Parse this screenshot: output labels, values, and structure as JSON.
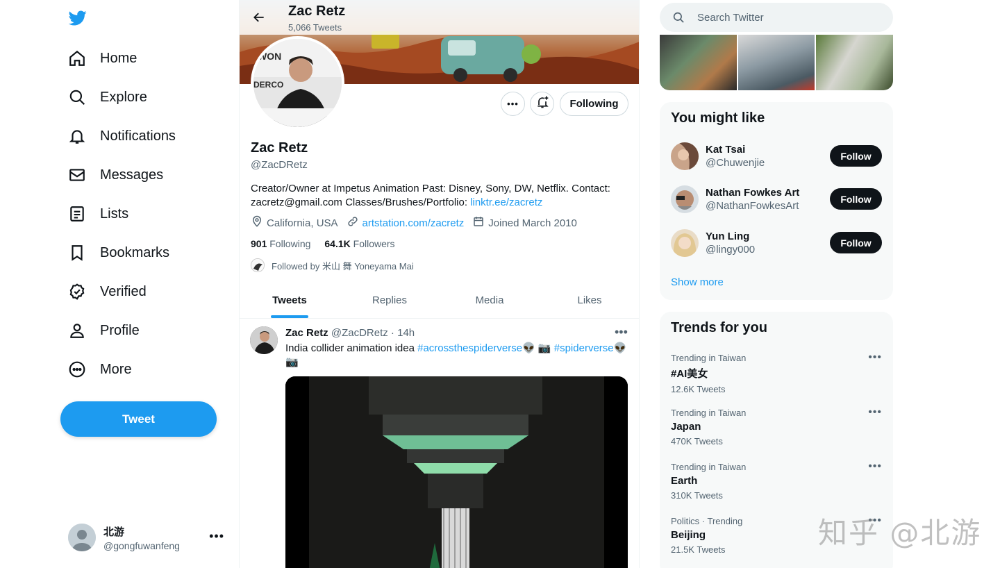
{
  "nav": {
    "items": [
      {
        "label": "Home",
        "icon": "home-icon"
      },
      {
        "label": "Explore",
        "icon": "search-icon"
      },
      {
        "label": "Notifications",
        "icon": "bell-icon"
      },
      {
        "label": "Messages",
        "icon": "mail-icon"
      },
      {
        "label": "Lists",
        "icon": "list-icon"
      },
      {
        "label": "Bookmarks",
        "icon": "bookmark-icon"
      },
      {
        "label": "Verified",
        "icon": "verified-icon"
      },
      {
        "label": "Profile",
        "icon": "person-icon"
      },
      {
        "label": "More",
        "icon": "more-circle-icon"
      }
    ],
    "tweet_button": "Tweet",
    "account": {
      "name": "北游",
      "handle": "@gongfuwanfeng"
    }
  },
  "colors": {
    "accent": "#1d9bf0",
    "text": "#0f1419",
    "muted": "#536471"
  },
  "profile": {
    "header_name": "Zac Retz",
    "tweet_count": "5,066 Tweets",
    "name": "Zac Retz",
    "handle": "@ZacDRetz",
    "bio_text": "Creator/Owner at Impetus Animation Past: Disney, Sony, DW, Netflix. Contact: zacretz@gmail.com Classes/Brushes/Portfolio: ",
    "bio_link": "linktr.ee/zacretz",
    "location": "California, USA",
    "website": "artstation.com/zacretz",
    "joined": "Joined March 2010",
    "following_count": "901",
    "following_label": "Following",
    "followers_count": "64.1K",
    "followers_label": "Followers",
    "followed_by": "Followed by 米山 舞 Yoneyama Mai",
    "following_button": "Following"
  },
  "tabs": [
    "Tweets",
    "Replies",
    "Media",
    "Likes"
  ],
  "tweet": {
    "name": "Zac Retz",
    "meta": "@ZacDRetz · 14h",
    "text": "India collider animation idea",
    "hashtag1": "#acrossthespiderverse",
    "hashtag2": "#spiderverse",
    "emoji1": "👽 📷",
    "emoji2": "👽",
    "emoji3": "📷"
  },
  "search": {
    "placeholder": "Search Twitter"
  },
  "you_might_like": {
    "title": "You might like",
    "users": [
      {
        "name": "Kat Tsai",
        "handle": "@Chuwenjie",
        "button": "Follow"
      },
      {
        "name": "Nathan Fowkes Art",
        "handle": "@NathanFowkesArt",
        "button": "Follow"
      },
      {
        "name": "Yun Ling",
        "handle": "@lingy000",
        "button": "Follow"
      }
    ],
    "show_more": "Show more"
  },
  "trends": {
    "title": "Trends for you",
    "items": [
      {
        "context": "Trending in Taiwan",
        "topic": "#AI美女",
        "count": "12.6K Tweets"
      },
      {
        "context": "Trending in Taiwan",
        "topic": "Japan",
        "count": "470K Tweets"
      },
      {
        "context": "Trending in Taiwan",
        "topic": "Earth",
        "count": "310K Tweets"
      },
      {
        "context": "Politics · Trending",
        "topic": "Beijing",
        "count": "21.5K Tweets"
      }
    ]
  },
  "watermark": "知乎 @北游"
}
